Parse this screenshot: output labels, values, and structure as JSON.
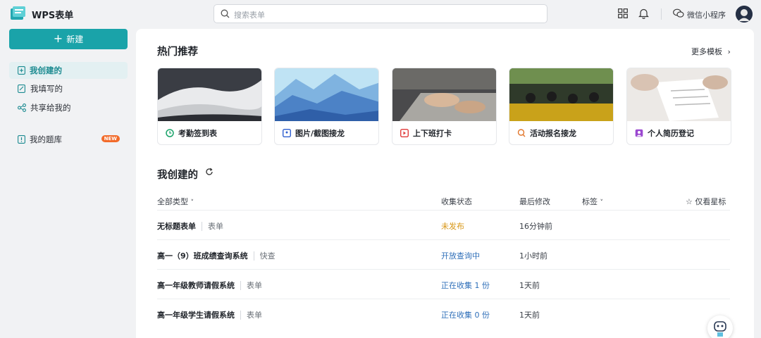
{
  "app": {
    "title": "WPS表单"
  },
  "search": {
    "placeholder": "搜索表单"
  },
  "header": {
    "mini_program": "微信小程序"
  },
  "sidebar": {
    "new_label": "新建",
    "items": [
      {
        "label": "我创建的"
      },
      {
        "label": "我填写的"
      },
      {
        "label": "共享给我的"
      },
      {
        "label": "我的题库",
        "badge": "NEW"
      }
    ]
  },
  "hot": {
    "title": "热门推荐",
    "more": "更多模板",
    "cards": [
      {
        "label": "考勤签到表"
      },
      {
        "label": "图片/截图接龙"
      },
      {
        "label": "上下班打卡"
      },
      {
        "label": "活动报名接龙"
      },
      {
        "label": "个人简历登记"
      }
    ]
  },
  "mine": {
    "title": "我创建的",
    "columns": {
      "type": "全部类型",
      "status": "收集状态",
      "modified": "最后修改",
      "tags": "标签",
      "star": "仅看星标"
    },
    "rows": [
      {
        "name": "无标题表单",
        "type": "表单",
        "status": "未发布",
        "time": "16分钟前"
      },
      {
        "name": "高一（9）班成绩查询系统",
        "type": "快查",
        "status": "开放查询中",
        "time": "1小时前"
      },
      {
        "name": "高一年级教师请假系统",
        "type": "表单",
        "status": "正在收集 1 份",
        "time": "1天前"
      },
      {
        "name": "高一年级学生请假系统",
        "type": "表单",
        "status": "正在收集 0 份",
        "time": "1天前"
      }
    ]
  }
}
